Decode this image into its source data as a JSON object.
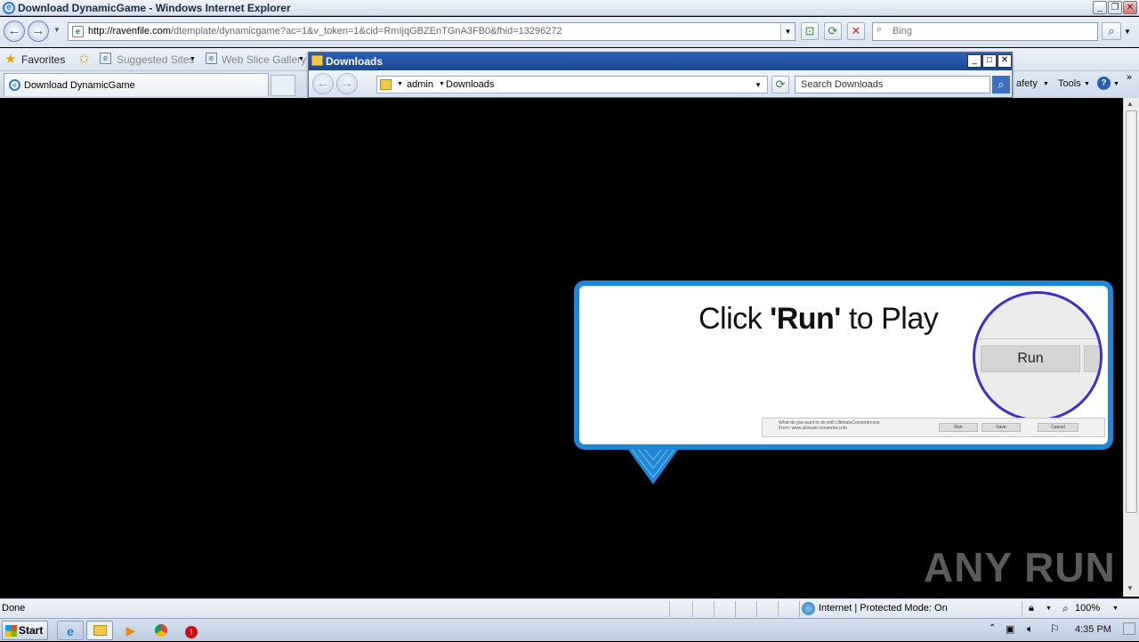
{
  "window": {
    "title": "Download DynamicGame - Windows Internet Explorer"
  },
  "address": {
    "url_domain": "http://ravenfile.com",
    "url_path": "/dtemplate/dynamicgame?ac=1&v_token=1&cid=RmIjqGBZEnTGnA3FB0&fhid=13296272"
  },
  "search": {
    "placeholder": "Bing"
  },
  "favorites": {
    "label": "Favorites",
    "suggested": "Suggested Sites",
    "webslice": "Web Slice Gallery"
  },
  "tab": {
    "title": "Download DynamicGame"
  },
  "commandbar": {
    "safety": "afety",
    "tools": "Tools"
  },
  "downloads_window": {
    "title": "Downloads",
    "path": [
      "admin",
      "Downloads"
    ],
    "search_text": "Search Downloads"
  },
  "banner": {
    "click": "Click ",
    "run_bold": "'Run'",
    "to_play": " to Play",
    "run_button": "Run",
    "mini_dialog_line1": "What do you want to do with UltimateConverter.exe",
    "mini_dialog_line2": "From: www.ultimate-converter.com",
    "mini_run": "Run",
    "mini_save": "Save",
    "mini_cancel": "Cancel"
  },
  "statusbar": {
    "status": "Done",
    "zone": "Internet | Protected Mode: On",
    "zoom": "100%"
  },
  "taskbar": {
    "start": "Start",
    "time": "4:35 PM"
  },
  "watermark": "ANY RUN",
  "colors": {
    "banner_border": "#1f87d8",
    "circle_border": "#3b2fd0",
    "titlebar_blue": "#1c4791"
  }
}
